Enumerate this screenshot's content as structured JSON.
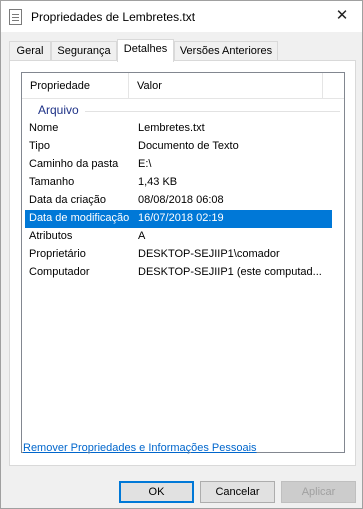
{
  "window": {
    "title": "Propriedades de Lembretes.txt",
    "close_glyph": "✕"
  },
  "tabs": [
    {
      "label": "Geral"
    },
    {
      "label": "Segurança"
    },
    {
      "label": "Detalhes"
    },
    {
      "label": "Versões Anteriores"
    }
  ],
  "list": {
    "headers": {
      "property": "Propriedade",
      "value": "Valor"
    },
    "group": "Arquivo",
    "rows": [
      {
        "key": "Nome",
        "value": "Lembretes.txt"
      },
      {
        "key": "Tipo",
        "value": "Documento de Texto"
      },
      {
        "key": "Caminho da pasta",
        "value": "E:\\"
      },
      {
        "key": "Tamanho",
        "value": "1,43 KB"
      },
      {
        "key": "Data da criação",
        "value": "08/08/2018 06:08"
      },
      {
        "key": "Data de modificação",
        "value": "16/07/2018 02:19"
      },
      {
        "key": "Atributos",
        "value": "A"
      },
      {
        "key": "Proprietário",
        "value": "DESKTOP-SEJIIP1\\comador"
      },
      {
        "key": "Computador",
        "value": "DESKTOP-SEJIIP1 (este computad..."
      }
    ]
  },
  "link_remove": "Remover Propriedades e Informações Pessoais",
  "buttons": {
    "ok": "OK",
    "cancel": "Cancelar",
    "apply": "Aplicar"
  },
  "colors": {
    "selection": "#0078d7",
    "group_label": "#1e3287",
    "link": "#0066cc"
  }
}
